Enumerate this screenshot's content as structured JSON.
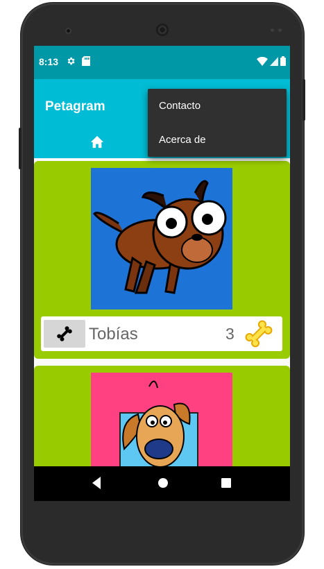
{
  "status_bar": {
    "time": "8:13",
    "icons": [
      "settings-gear-icon",
      "sd-card-icon",
      "wifi-icon",
      "signal-icon",
      "battery-icon"
    ]
  },
  "toolbar": {
    "title": "Petagram",
    "home_tab_icon": "home-icon",
    "indicator_color": "#ff5722"
  },
  "overflow_menu": {
    "items": [
      {
        "label": "Contacto"
      },
      {
        "label": "Acerca de"
      }
    ]
  },
  "pets": [
    {
      "name": "Tobías",
      "likes": "3",
      "photo": "cartoon-brown-dog",
      "photo_bg": "#1e74d6"
    },
    {
      "name": "",
      "likes": "",
      "photo": "cartoon-tan-dog",
      "photo_bg": "#ff4081"
    }
  ],
  "colors": {
    "status_bar": "#0097a7",
    "toolbar": "#00bcd4",
    "card": "#99cc00",
    "menu": "#303030"
  },
  "nav_bar": {
    "icons": [
      "back-icon",
      "home-circle-icon",
      "recents-icon"
    ]
  }
}
